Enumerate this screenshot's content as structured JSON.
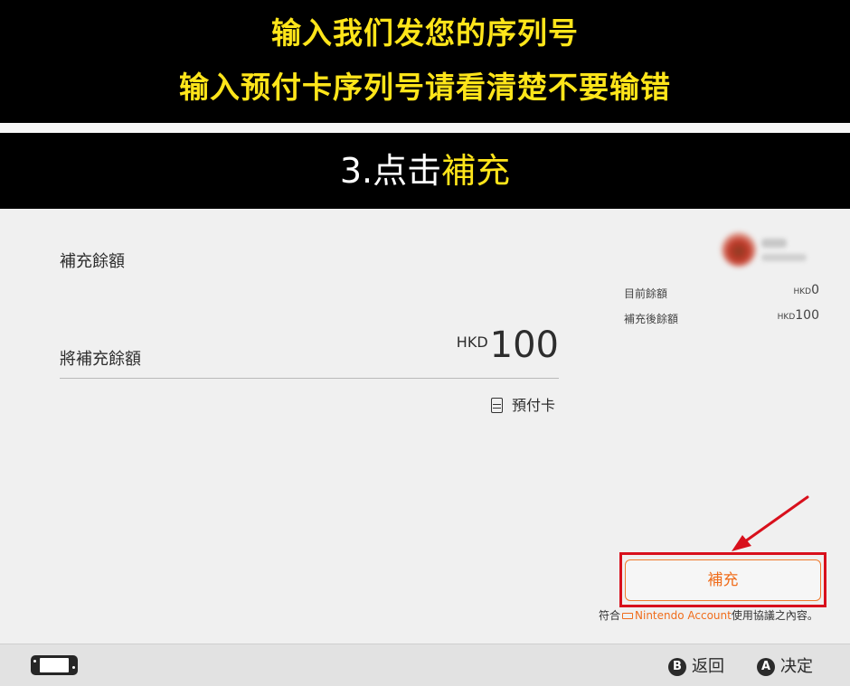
{
  "banner": {
    "line1": "输入我们发您的序列号",
    "line2": "输入预付卡序列号请看清楚不要输错",
    "step_prefix": "3.点击",
    "step_highlight": "補充"
  },
  "main": {
    "title": "補充餘額",
    "amount_label": "將補充餘額",
    "amount_currency": "HKD",
    "amount_value": "100",
    "payment_method": "預付卡"
  },
  "account": {
    "current_balance_label": "目前餘額",
    "current_balance_currency": "HKD",
    "current_balance_value": "0",
    "after_balance_label": "補充後餘額",
    "after_balance_currency": "HKD",
    "after_balance_value": "100"
  },
  "actions": {
    "topup_button": "補充",
    "terms_prefix": "符合",
    "terms_link": "Nintendo Account",
    "terms_suffix": "使用協議之內容。"
  },
  "footer": {
    "back_key": "B",
    "back_label": "返回",
    "confirm_key": "A",
    "confirm_label": "决定"
  },
  "colors": {
    "banner_bg": "#000000",
    "banner_text": "#ffe51a",
    "accent_orange": "#f06d1c",
    "highlight_red": "#d8101c"
  },
  "icons": [
    "prepaid-card-icon",
    "link-icon",
    "console-icon",
    "b-button-icon",
    "a-button-icon",
    "arrow-icon"
  ]
}
